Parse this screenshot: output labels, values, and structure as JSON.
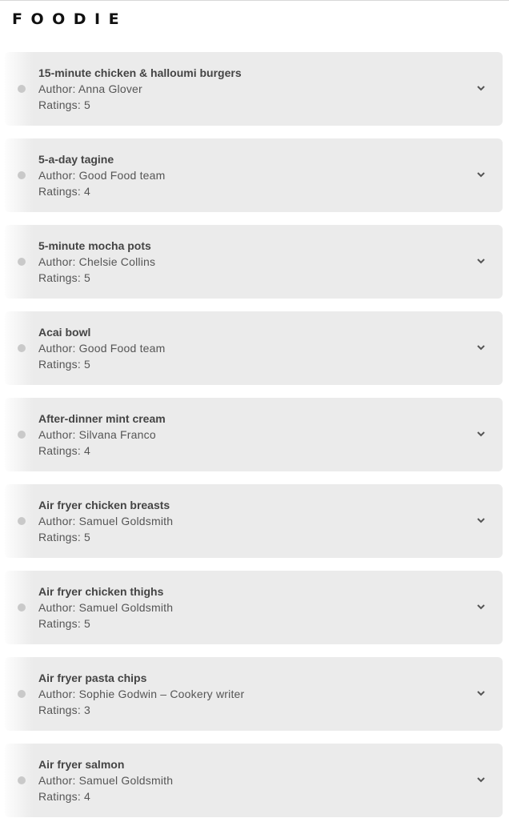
{
  "header": {
    "logo": "FOODIE"
  },
  "recipes": [
    {
      "title": "15-minute chicken & halloumi burgers",
      "author": "Author: Anna Glover",
      "ratings": "Ratings: 5"
    },
    {
      "title": "5-a-day tagine",
      "author": "Author: Good Food team",
      "ratings": "Ratings: 4"
    },
    {
      "title": "5-minute mocha pots",
      "author": "Author: Chelsie Collins",
      "ratings": "Ratings: 5"
    },
    {
      "title": "Acai bowl",
      "author": "Author: Good Food team",
      "ratings": "Ratings: 5"
    },
    {
      "title": "After-dinner mint cream",
      "author": "Author: Silvana Franco",
      "ratings": "Ratings: 4"
    },
    {
      "title": "Air fryer chicken breasts",
      "author": "Author: Samuel Goldsmith",
      "ratings": "Ratings: 5"
    },
    {
      "title": "Air fryer chicken thighs",
      "author": "Author: Samuel Goldsmith",
      "ratings": "Ratings: 5"
    },
    {
      "title": "Air fryer pasta chips",
      "author": "Author: Sophie Godwin – Cookery writer",
      "ratings": "Ratings: 3"
    },
    {
      "title": "Air fryer salmon",
      "author": "Author: Samuel Goldsmith",
      "ratings": "Ratings: 4"
    }
  ],
  "icons": {
    "bullet": "dot-icon",
    "expand": "chevron-down-icon"
  }
}
